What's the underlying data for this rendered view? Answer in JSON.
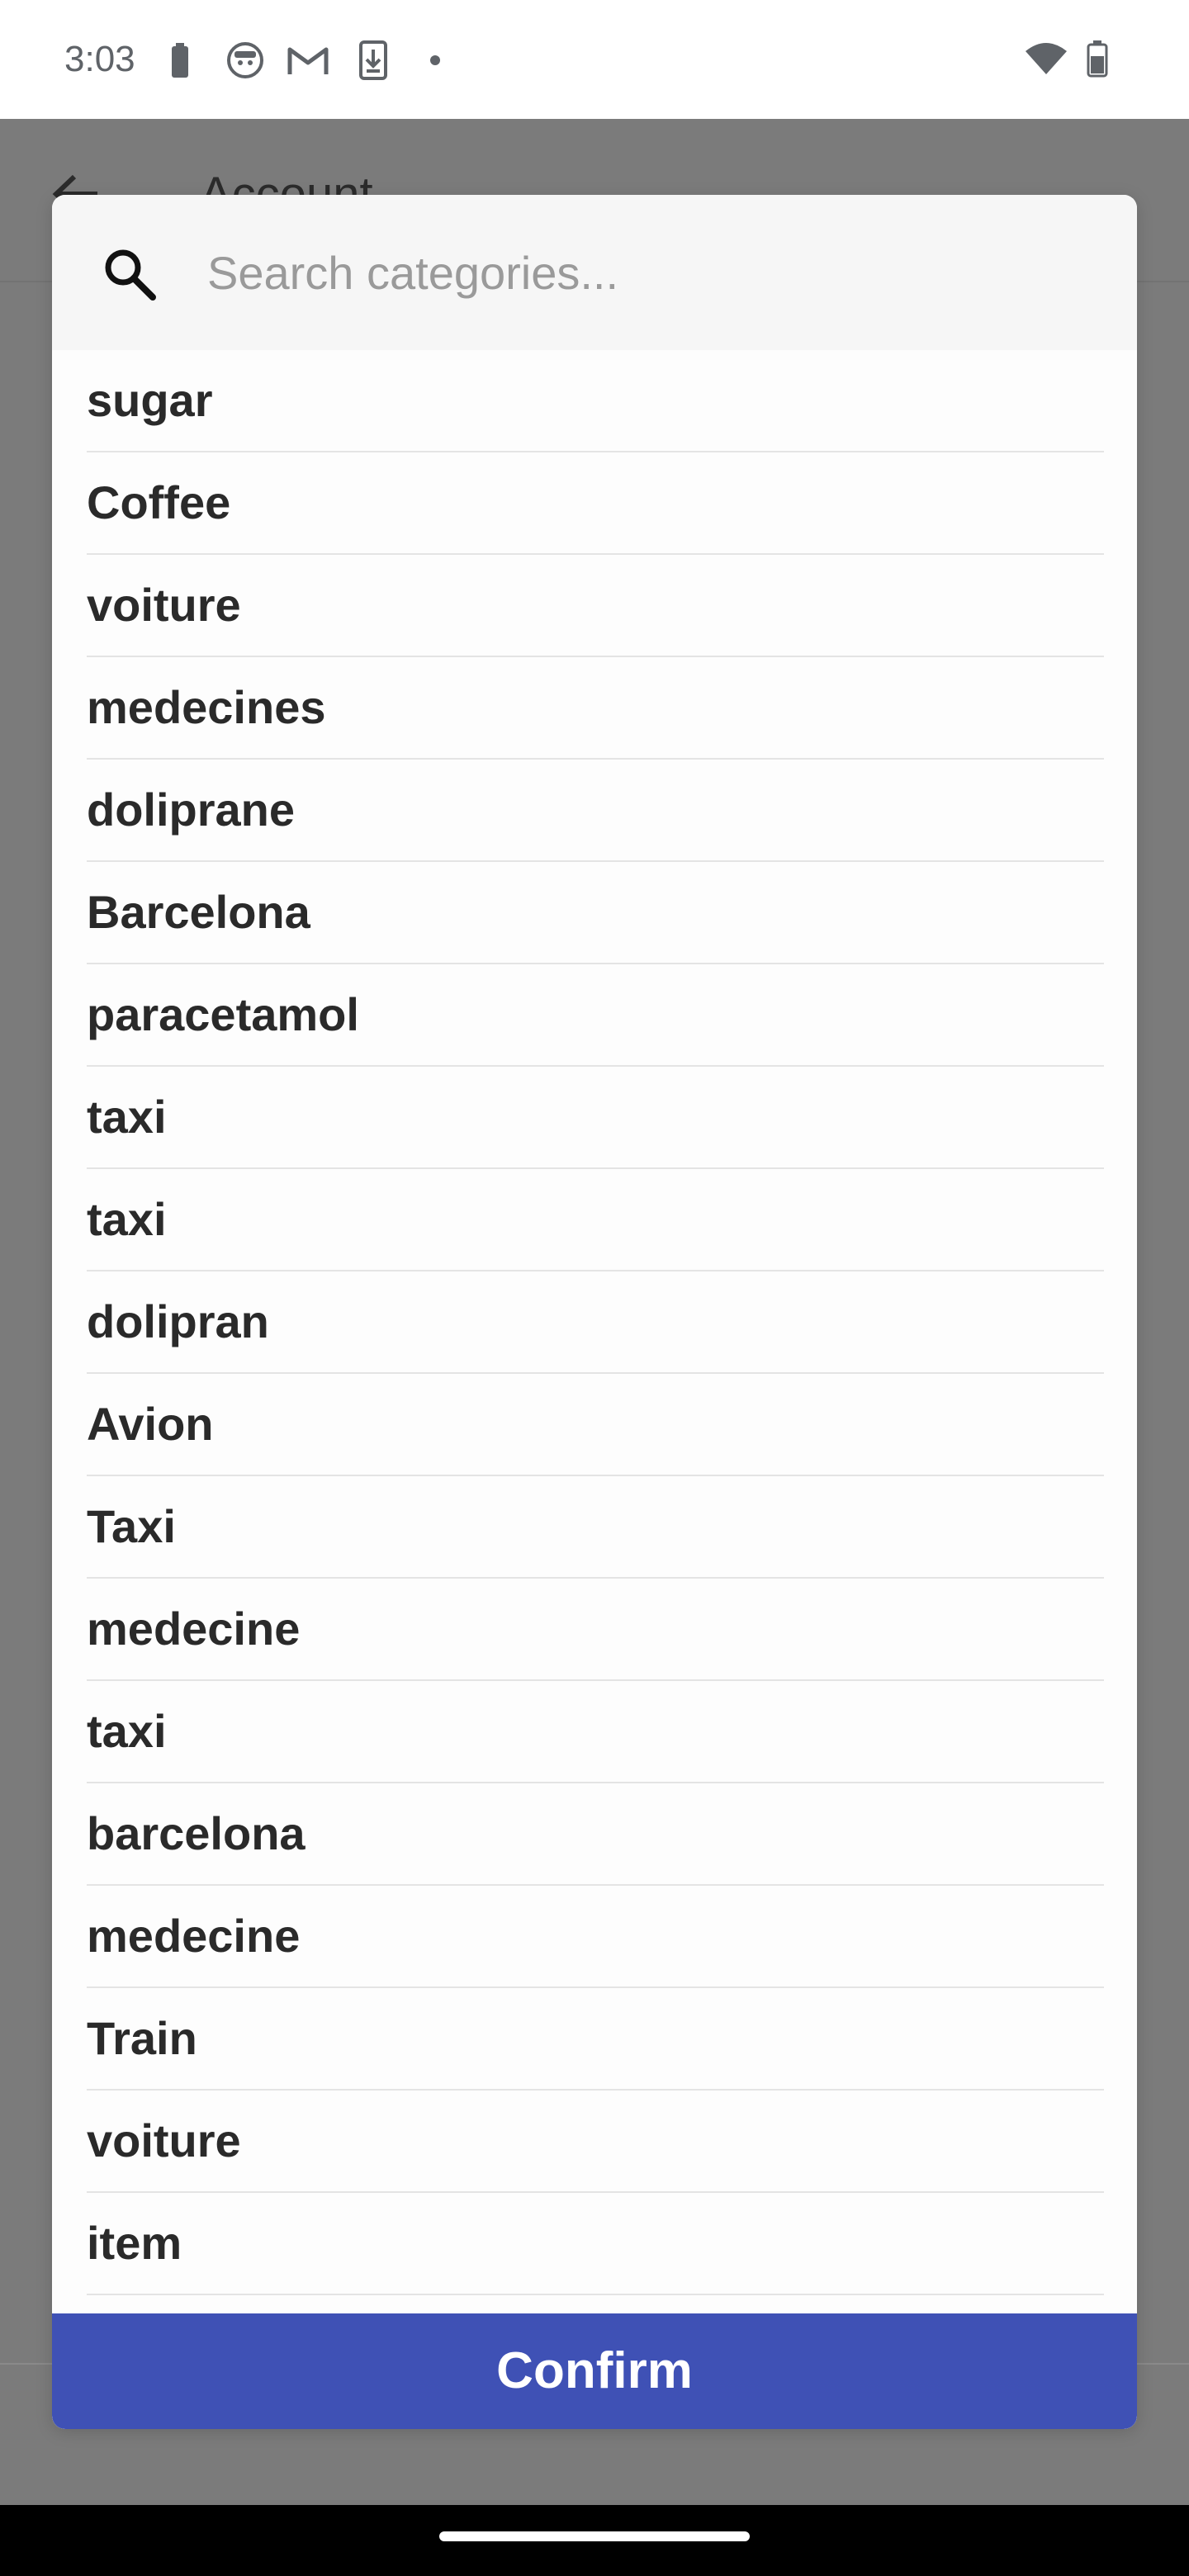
{
  "status_bar": {
    "time": "3:03",
    "icons": [
      "battery-saver-icon",
      "app-face-icon",
      "gmail-icon",
      "download-icon",
      "dot-icon",
      "wifi-icon",
      "battery-icon"
    ]
  },
  "background_screen": {
    "title": "Account"
  },
  "dialog": {
    "search": {
      "placeholder": "Search categories...",
      "value": ""
    },
    "items": [
      "sugar",
      "Coffee",
      "voiture",
      "medecines",
      "doliprane",
      "Barcelona",
      "paracetamol",
      "taxi",
      "taxi",
      "dolipran",
      "Avion",
      "Taxi",
      "medecine",
      "taxi",
      "barcelona",
      "medecine",
      "Train",
      "voiture",
      "item"
    ],
    "confirm_label": "Confirm"
  },
  "colors": {
    "accent": "#3f51b5",
    "scrim": "#7b7b7b"
  }
}
